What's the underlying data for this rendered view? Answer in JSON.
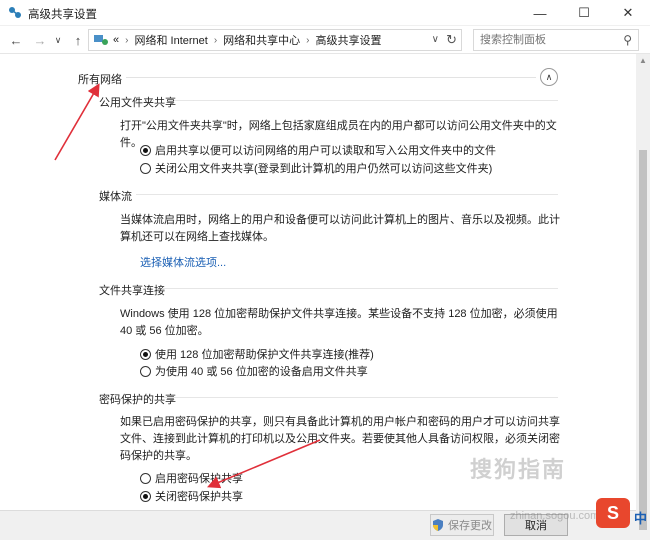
{
  "window": {
    "title": "高级共享设置"
  },
  "nav": {
    "breadcrumb": [
      "网络和 Internet",
      "网络和共享中心",
      "高级共享设置"
    ],
    "breadcrumb_prefix": "«",
    "search_placeholder": "搜索控制面板"
  },
  "section": {
    "title": "所有网络",
    "groups": {
      "public_folder": {
        "title": "公用文件夹共享",
        "description": "打开\"公用文件夹共享\"时，网络上包括家庭组成员在内的用户都可以访问公用文件夹中的文件。",
        "options": [
          "启用共享以便可以访问网络的用户可以读取和写入公用文件夹中的文件",
          "关闭公用文件夹共享(登录到此计算机的用户仍然可以访问这些文件夹)"
        ],
        "selected": 0
      },
      "media": {
        "title": "媒体流",
        "description": "当媒体流启用时，网络上的用户和设备便可以访问此计算机上的图片、音乐以及视频。此计算机还可以在网络上查找媒体。",
        "link": "选择媒体流选项..."
      },
      "file_sharing": {
        "title": "文件共享连接",
        "description": "Windows 使用 128 位加密帮助保护文件共享连接。某些设备不支持 128 位加密，必须使用 40 或 56 位加密。",
        "options": [
          "使用 128 位加密帮助保护文件共享连接(推荐)",
          "为使用 40 或 56 位加密的设备启用文件共享"
        ],
        "selected": 0
      },
      "password": {
        "title": "密码保护的共享",
        "description": "如果已启用密码保护的共享，则只有具备此计算机的用户帐户和密码的用户才可以访问共享文件、连接到此计算机的打印机以及公用文件夹。若要使其他人具备访问权限，必须关闭密码保护的共享。",
        "options": [
          "启用密码保护共享",
          "关闭密码保护共享"
        ],
        "selected": 1
      }
    }
  },
  "footer": {
    "save_label": "保存更改",
    "cancel_label": "取消"
  },
  "watermark": {
    "text": "搜狗指南",
    "sub": "zhinan.sogou.com",
    "logo": "S",
    "corner": "中"
  },
  "colors": {
    "link": "#1a5fb4",
    "annotation_arrow": "#e0303a",
    "accent_logo": "#e8472d"
  }
}
